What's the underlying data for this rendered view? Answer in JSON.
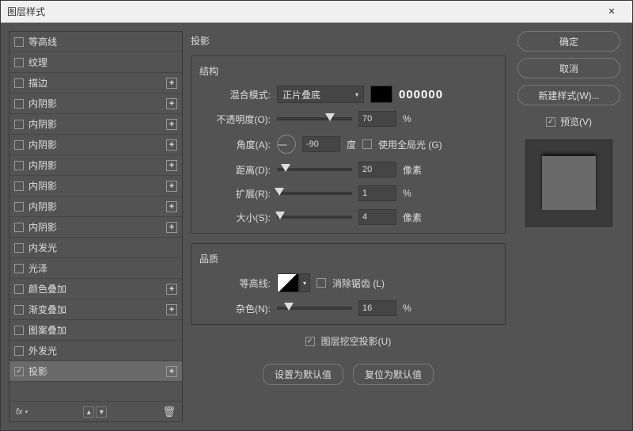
{
  "dialog": {
    "title": "图层样式"
  },
  "sidebar": {
    "items": [
      {
        "label": "等高线",
        "checked": false,
        "hasAdd": false
      },
      {
        "label": "纹理",
        "checked": false,
        "hasAdd": false
      },
      {
        "label": "描边",
        "checked": false,
        "hasAdd": true
      },
      {
        "label": "内阴影",
        "checked": false,
        "hasAdd": true
      },
      {
        "label": "内阴影",
        "checked": false,
        "hasAdd": true
      },
      {
        "label": "内阴影",
        "checked": false,
        "hasAdd": true
      },
      {
        "label": "内阴影",
        "checked": false,
        "hasAdd": true
      },
      {
        "label": "内阴影",
        "checked": false,
        "hasAdd": true
      },
      {
        "label": "内阴影",
        "checked": false,
        "hasAdd": true
      },
      {
        "label": "内阴影",
        "checked": false,
        "hasAdd": true
      },
      {
        "label": "内发光",
        "checked": false,
        "hasAdd": false
      },
      {
        "label": "光泽",
        "checked": false,
        "hasAdd": false
      },
      {
        "label": "颜色叠加",
        "checked": false,
        "hasAdd": true
      },
      {
        "label": "渐变叠加",
        "checked": false,
        "hasAdd": true
      },
      {
        "label": "图案叠加",
        "checked": false,
        "hasAdd": false
      },
      {
        "label": "外发光",
        "checked": false,
        "hasAdd": false
      },
      {
        "label": "投影",
        "checked": true,
        "hasAdd": true,
        "active": true
      }
    ],
    "fx": "fx"
  },
  "panel": {
    "title": "投影",
    "structure": {
      "title": "结构",
      "blendMode": {
        "label": "混合模式:",
        "value": "正片叠底",
        "hex": "000000"
      },
      "opacity": {
        "label": "不透明度(O):",
        "value": "70",
        "unit": "%",
        "pos": 70
      },
      "angle": {
        "label": "角度(A):",
        "value": "-90",
        "unit": "度",
        "globalLight": "使用全局光 (G)",
        "globalChecked": false
      },
      "distance": {
        "label": "距离(D):",
        "value": "20",
        "unit": "像素",
        "pos": 12
      },
      "spread": {
        "label": "扩展(R):",
        "value": "1",
        "unit": "%",
        "pos": 3
      },
      "size": {
        "label": "大小(S):",
        "value": "4",
        "unit": "像素",
        "pos": 4
      }
    },
    "quality": {
      "title": "品质",
      "contour": {
        "label": "等高线:",
        "antialias": "消除锯齿 (L)",
        "antialiasChecked": false
      },
      "noise": {
        "label": "杂色(N):",
        "value": "16",
        "unit": "%",
        "pos": 16
      }
    },
    "knockout": {
      "label": "图层挖空投影(U)",
      "checked": true
    },
    "buttons": {
      "default": "设置为默认值",
      "reset": "复位为默认值"
    }
  },
  "actions": {
    "ok": "确定",
    "cancel": "取消",
    "newStyle": "新建样式(W)...",
    "preview": "预览(V)",
    "previewChecked": true
  }
}
